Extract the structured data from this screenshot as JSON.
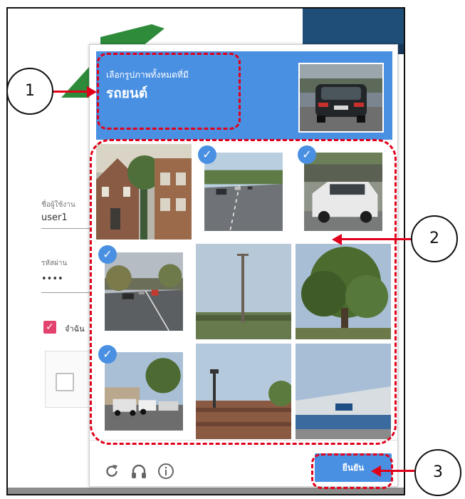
{
  "background": {
    "username_label": "ชื่อผู้ใช้งาน",
    "username_value": "user1",
    "password_label": "รหัสผ่าน",
    "password_value": "••••",
    "remember_label": "จำฉัน"
  },
  "captcha": {
    "instruction": "เลือกรูปภาพทั้งหมดที่มี",
    "target": "รถยนต์",
    "verify_label": "ยืนยัน",
    "check_mark": "✓",
    "icons": {
      "reload": "reload-icon",
      "audio": "headphones-icon",
      "info": "info-icon"
    }
  },
  "annotations": {
    "callout_1": "1",
    "callout_2": "2",
    "callout_3": "3",
    "color": "#e0001b"
  }
}
